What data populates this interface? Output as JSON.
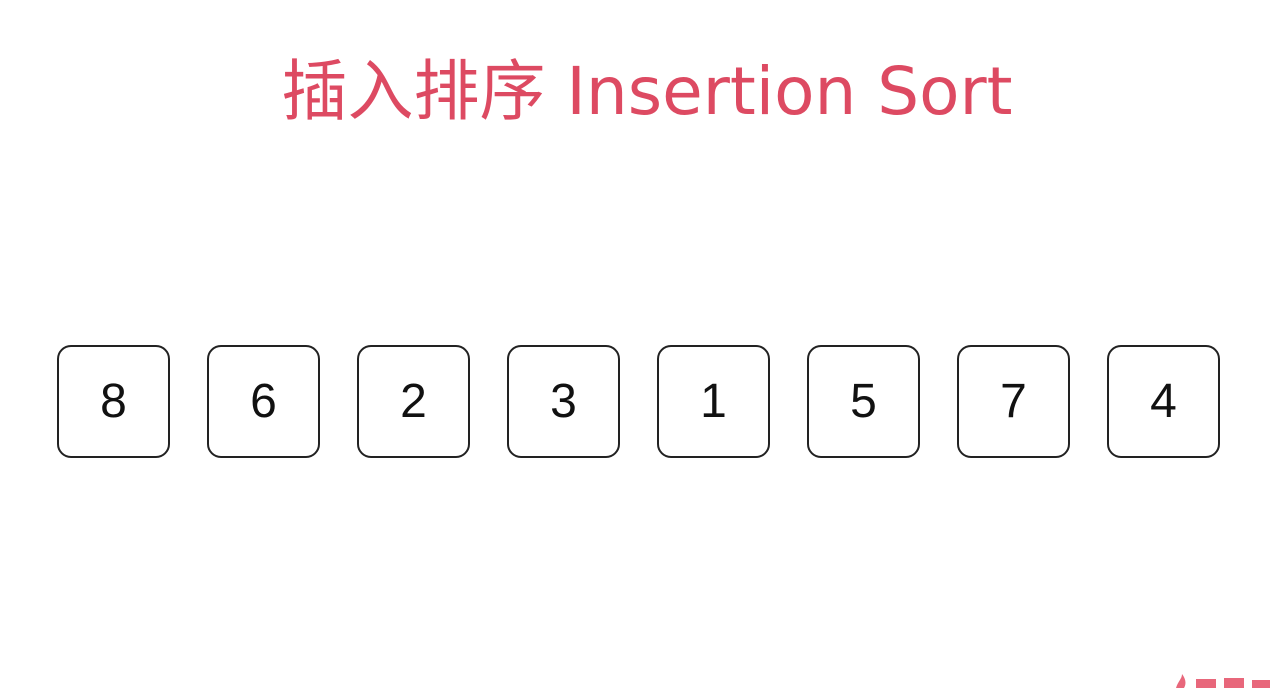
{
  "title": "插入排序 Insertion Sort",
  "colors": {
    "title": "#dd4a62",
    "box_border": "#222222",
    "box_text": "#111111",
    "background": "#ffffff",
    "watermark": "#e8677b"
  },
  "array": {
    "values": [
      "8",
      "6",
      "2",
      "3",
      "1",
      "5",
      "7",
      "4"
    ]
  }
}
